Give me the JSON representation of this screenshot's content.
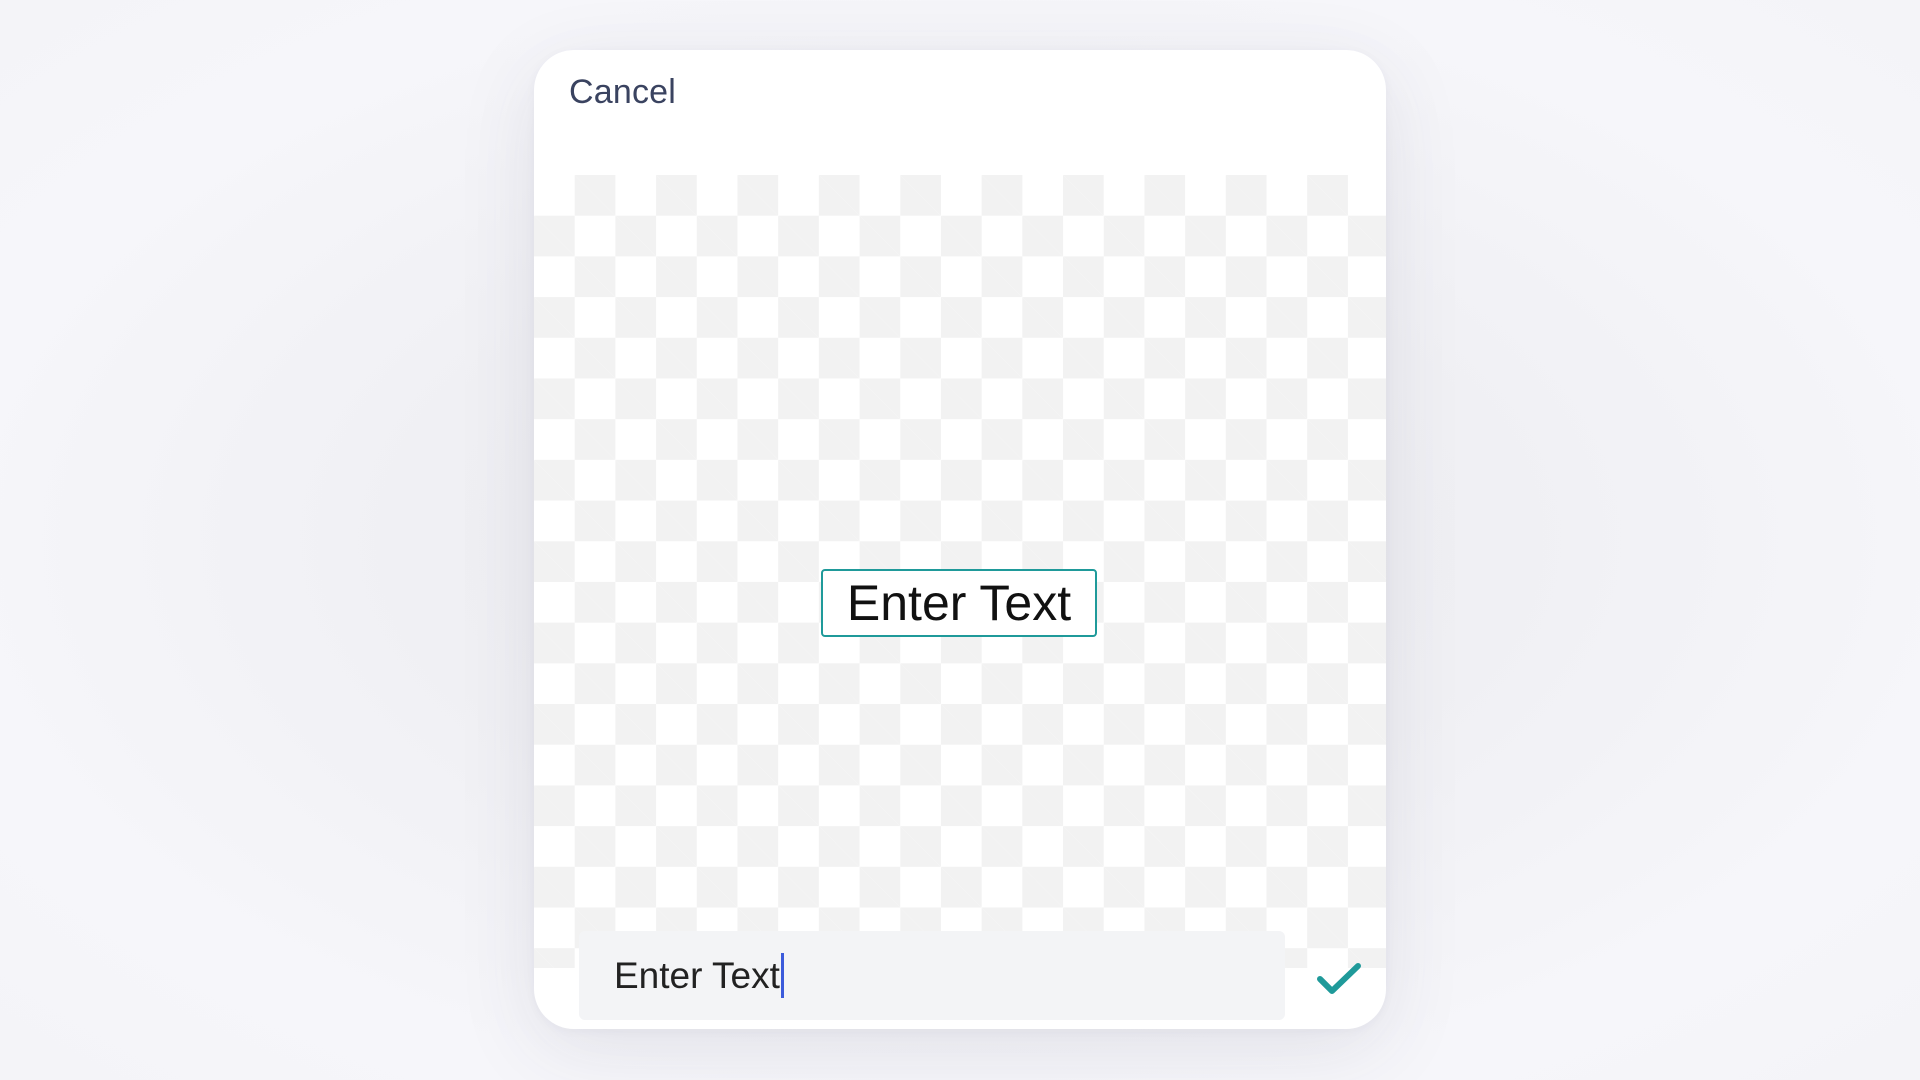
{
  "header": {
    "cancel_label": "Cancel"
  },
  "canvas": {
    "text_element": "Enter Text"
  },
  "editor": {
    "input_value": "Enter Text"
  },
  "colors": {
    "accent": "#1f9a9a",
    "caret": "#3b5bdb",
    "cancel_text": "#3a4360"
  },
  "icons": {
    "confirm": "checkmark-icon"
  }
}
